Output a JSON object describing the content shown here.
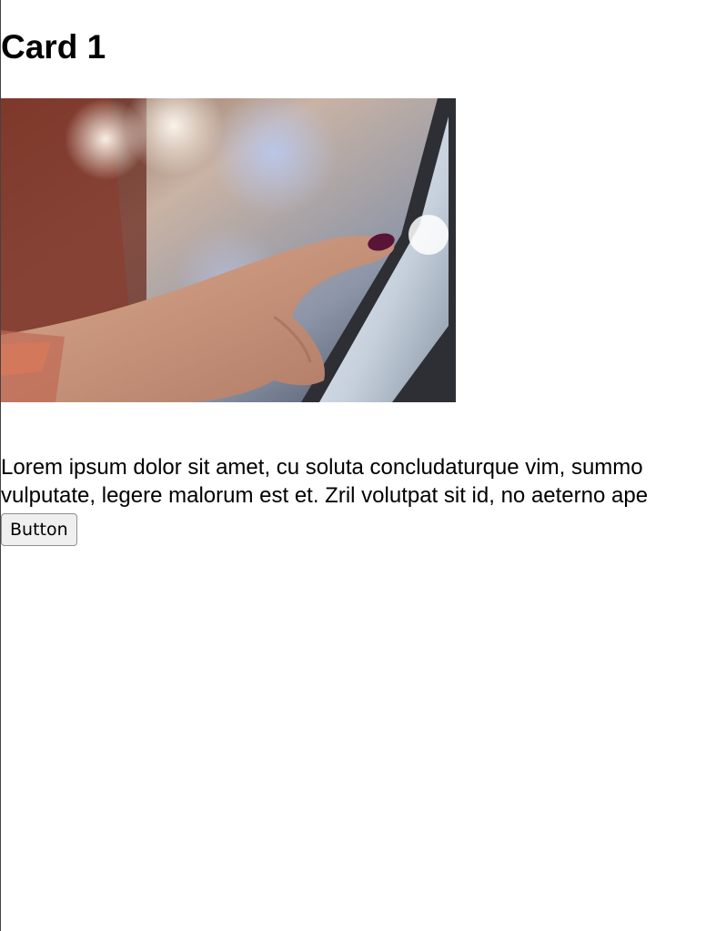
{
  "card": {
    "title": "Card 1",
    "text_lines": [
      "Lorem ipsum dolor sit amet, cu soluta concludaturque vim, summo",
      "vulputate, legere malorum est et. Zril volutpat sit id, no aeterno ape"
    ],
    "button_label": "Button",
    "image_icon": "photo-hand-touching-tablet"
  }
}
